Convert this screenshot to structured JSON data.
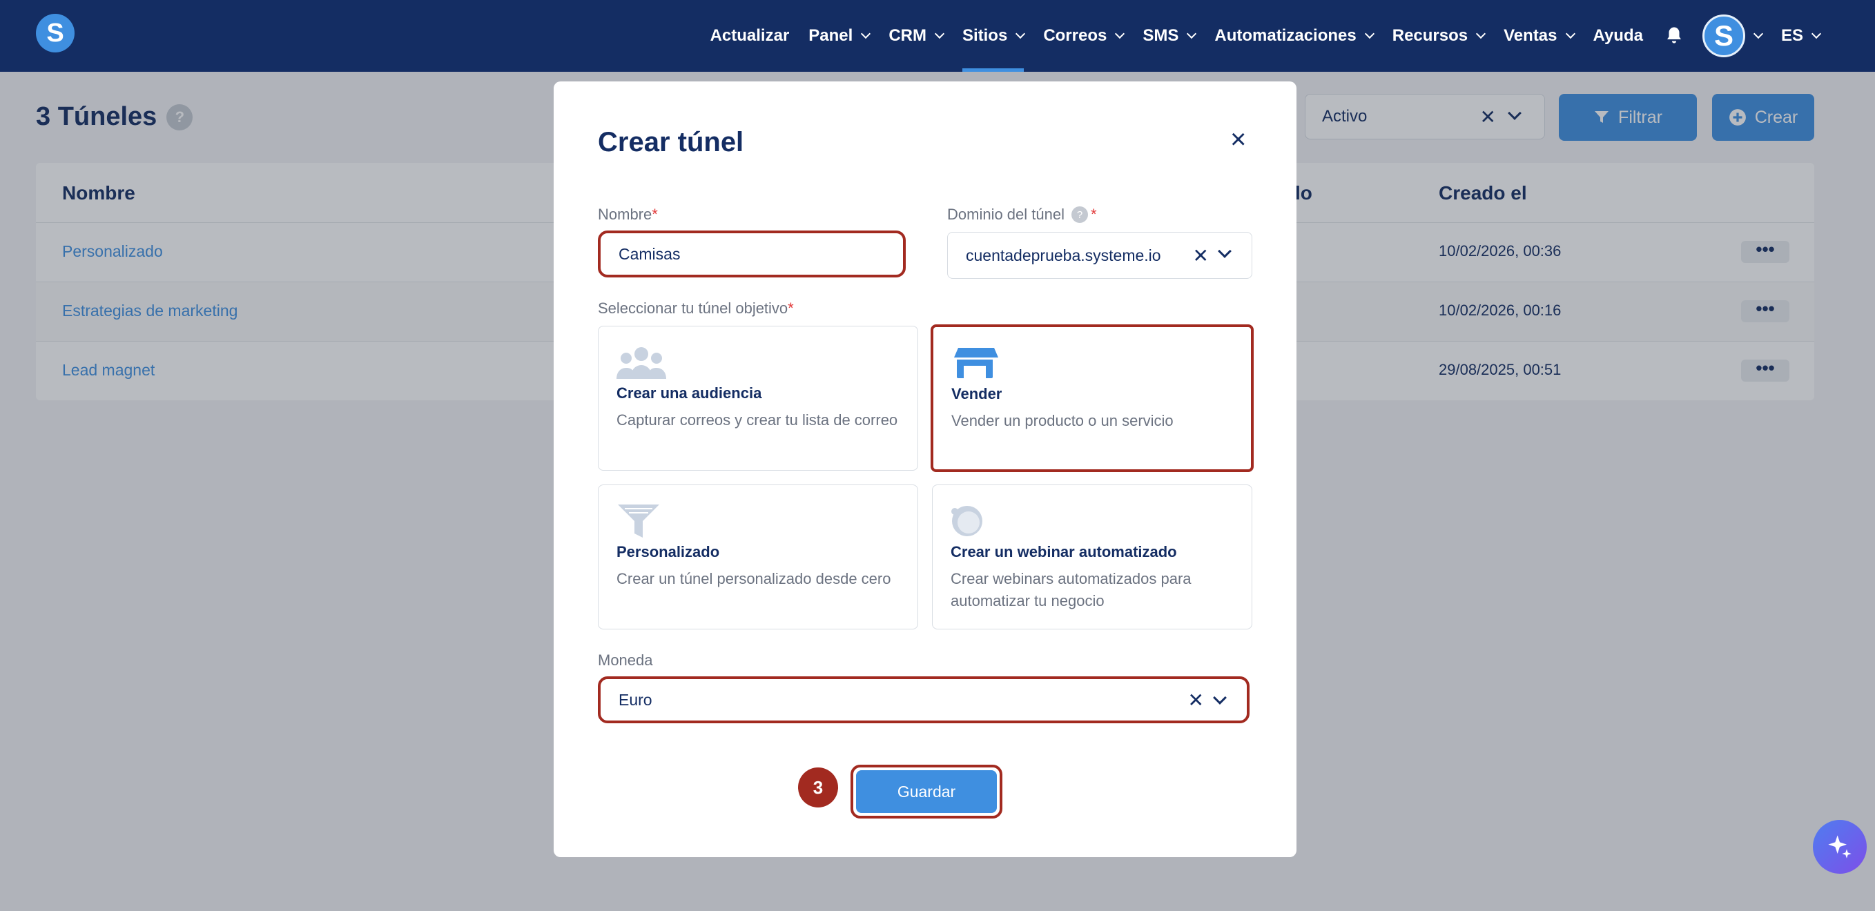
{
  "nav": {
    "items": [
      {
        "label": "Actualizar",
        "dropdown": false
      },
      {
        "label": "Panel",
        "dropdown": true
      },
      {
        "label": "CRM",
        "dropdown": true
      },
      {
        "label": "Sitios",
        "dropdown": true,
        "active": true
      },
      {
        "label": "Correos",
        "dropdown": true
      },
      {
        "label": "SMS",
        "dropdown": true
      },
      {
        "label": "Automatizaciones",
        "dropdown": true
      },
      {
        "label": "Recursos",
        "dropdown": true
      },
      {
        "label": "Ventas",
        "dropdown": true
      },
      {
        "label": "Ayuda",
        "dropdown": false
      }
    ],
    "logo_letter": "S",
    "avatar_letter": "S",
    "language": "ES"
  },
  "page": {
    "title": "3 Túneles",
    "help": "?",
    "status_filter": "Activo",
    "filter_button": "Filtrar",
    "create_button": "Crear"
  },
  "table": {
    "col_name": "Nombre",
    "col_partial": "lo",
    "col_created": "Creado el",
    "rows": [
      {
        "name": "Personalizado",
        "created": "10/02/2026, 00:36"
      },
      {
        "name": "Estrategias de marketing",
        "created": "10/02/2026, 00:16"
      },
      {
        "name": "Lead magnet",
        "created": "29/08/2025, 00:51"
      }
    ],
    "row_menu": "•••"
  },
  "modal": {
    "title": "Crear túnel",
    "close": "×",
    "name_label": "Nombre",
    "name_value": "Camisas",
    "domain_label": "Dominio del túnel",
    "domain_value": "cuentadeprueba.systeme.io",
    "goal_label": "Seleccionar tu túnel objetivo",
    "required_mark": "*",
    "clear": "✕",
    "cards": [
      {
        "title": "Crear una audiencia",
        "desc": "Capturar correos y crear tu lista de correo"
      },
      {
        "title": "Vender",
        "desc": "Vender un producto o un servicio"
      },
      {
        "title": "Personalizado",
        "desc": "Crear un túnel personalizado desde cero"
      },
      {
        "title": "Crear un webinar automatizado",
        "desc": "Crear webinars automatizados para automatizar tu negocio"
      }
    ],
    "currency_label": "Moneda",
    "currency_value": "Euro",
    "step": "3",
    "save": "Guardar"
  },
  "colors": {
    "navy": "#142d63",
    "blue": "#3f8fe0",
    "highlight": "#a22a20"
  }
}
